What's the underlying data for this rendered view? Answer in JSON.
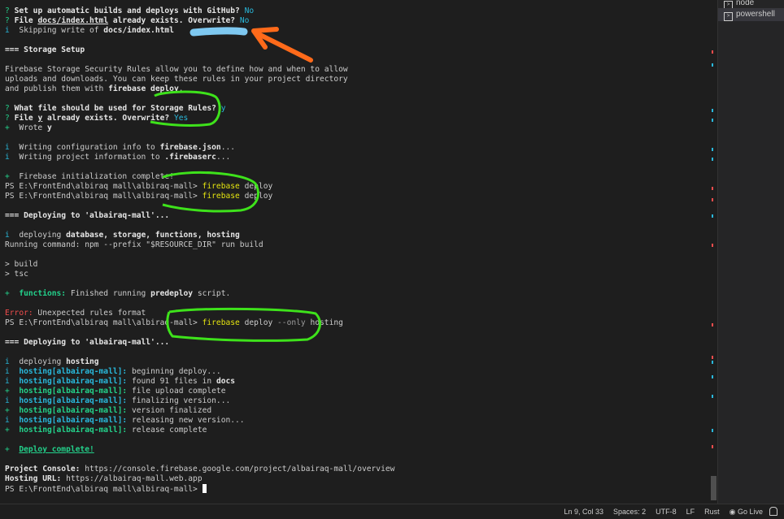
{
  "terminal": {
    "lines": [
      [
        [
          "? ",
          "green"
        ],
        [
          "Set up automatic builds and deploys with GitHub? ",
          "b"
        ],
        [
          "No",
          "cyan"
        ]
      ],
      [
        [
          "? ",
          "green"
        ],
        [
          "File ",
          "b"
        ],
        [
          "docs/index.html",
          "ul"
        ],
        [
          " already exists. Overwrite? ",
          "b"
        ],
        [
          "No",
          "cyan"
        ]
      ],
      [
        [
          "i  ",
          "cyan"
        ],
        [
          "Skipping write of ",
          "dim"
        ],
        [
          "docs/index.html",
          "b"
        ]
      ],
      [],
      [
        [
          "=== Storage Setup",
          "b"
        ]
      ],
      [],
      [
        [
          "Firebase Storage Security Rules allow you to define how and when to allow",
          "dim"
        ]
      ],
      [
        [
          "uploads and downloads. You can keep these rules in your project directory",
          "dim"
        ]
      ],
      [
        [
          "and publish them with ",
          "dim"
        ],
        [
          "firebase deploy",
          "b"
        ],
        [
          ".",
          "dim"
        ]
      ],
      [],
      [
        [
          "? ",
          "green"
        ],
        [
          "What file should be used for Storage Rules? ",
          "b"
        ],
        [
          "y",
          "cyan"
        ]
      ],
      [
        [
          "? ",
          "green"
        ],
        [
          "File ",
          "b"
        ],
        [
          "y",
          "ul"
        ],
        [
          " already exists. Overwrite? ",
          "b"
        ],
        [
          "Yes",
          "cyan"
        ]
      ],
      [
        [
          "+  ",
          "green"
        ],
        [
          "Wrote ",
          "dim"
        ],
        [
          "y",
          "b"
        ]
      ],
      [],
      [
        [
          "i  ",
          "cyan"
        ],
        [
          "Writing configuration info to ",
          "dim"
        ],
        [
          "firebase.json",
          "b"
        ],
        [
          "...",
          "dim"
        ]
      ],
      [
        [
          "i  ",
          "cyan"
        ],
        [
          "Writing project information to ",
          "dim"
        ],
        [
          ".firebaserc",
          "b"
        ],
        [
          "...",
          "dim"
        ]
      ],
      [],
      [
        [
          "+  ",
          "green"
        ],
        [
          "Firebase initialization complete!",
          "dim"
        ]
      ],
      [
        [
          "PS E:\\FrontEnd\\albiraq mall\\albiraq-mall> ",
          "dim"
        ],
        [
          "firebase",
          "yellow"
        ],
        [
          " deploy",
          "dim"
        ]
      ],
      [
        [
          "PS E:\\FrontEnd\\albiraq mall\\albiraq-mall> ",
          "dim"
        ],
        [
          "firebase",
          "yellow"
        ],
        [
          " deploy",
          "dim"
        ]
      ],
      [],
      [
        [
          "=== Deploying to 'albairaq-mall'...",
          "b"
        ]
      ],
      [],
      [
        [
          "i  ",
          "cyan"
        ],
        [
          "deploying ",
          "dim"
        ],
        [
          "database, storage, functions, hosting",
          "b"
        ]
      ],
      [
        [
          "Running command: npm --prefix \"$RESOURCE_DIR\" run build",
          "dim"
        ]
      ],
      [],
      [
        [
          "> build",
          "dim"
        ]
      ],
      [
        [
          "> tsc",
          "dim"
        ]
      ],
      [],
      [
        [
          "+  ",
          "green"
        ],
        [
          "functions:",
          "greenb"
        ],
        [
          " Finished running ",
          "dim"
        ],
        [
          "predeploy",
          "b"
        ],
        [
          " script.",
          "dim"
        ]
      ],
      [],
      [
        [
          "Error:",
          "red"
        ],
        [
          " Unexpected rules format",
          "dim"
        ]
      ],
      [
        [
          "PS E:\\FrontEnd\\albiraq mall\\albiraq-mall> ",
          "dim"
        ],
        [
          "firebase",
          "yellow"
        ],
        [
          " deploy ",
          "dim"
        ],
        [
          "--only",
          "gray"
        ],
        [
          " hosting",
          "dim"
        ]
      ],
      [],
      [
        [
          "=== Deploying to 'albairaq-mall'...",
          "b"
        ]
      ],
      [],
      [
        [
          "i  ",
          "cyan"
        ],
        [
          "deploying ",
          "dim"
        ],
        [
          "hosting",
          "b"
        ]
      ],
      [
        [
          "i  ",
          "cyan"
        ],
        [
          "hosting[albairaq-mall]:",
          "cyanb"
        ],
        [
          " beginning deploy...",
          "dim"
        ]
      ],
      [
        [
          "i  ",
          "cyan"
        ],
        [
          "hosting[albairaq-mall]:",
          "cyanb"
        ],
        [
          " found 91 files in ",
          "dim"
        ],
        [
          "docs",
          "b"
        ]
      ],
      [
        [
          "+  ",
          "green"
        ],
        [
          "hosting[albairaq-mall]:",
          "greenb"
        ],
        [
          " file upload complete",
          "dim"
        ]
      ],
      [
        [
          "i  ",
          "cyan"
        ],
        [
          "hosting[albairaq-mall]:",
          "cyanb"
        ],
        [
          " finalizing version...",
          "dim"
        ]
      ],
      [
        [
          "+  ",
          "green"
        ],
        [
          "hosting[albairaq-mall]:",
          "greenb"
        ],
        [
          " version finalized",
          "dim"
        ]
      ],
      [
        [
          "i  ",
          "cyan"
        ],
        [
          "hosting[albairaq-mall]:",
          "cyanb"
        ],
        [
          " releasing new version...",
          "dim"
        ]
      ],
      [
        [
          "+  ",
          "green"
        ],
        [
          "hosting[albairaq-mall]:",
          "greenb"
        ],
        [
          " release complete",
          "dim"
        ]
      ],
      [],
      [
        [
          "+  ",
          "green"
        ],
        [
          "Deploy complete!",
          "ulg"
        ]
      ],
      [],
      [
        [
          "Project Console:",
          "b"
        ],
        [
          " https://console.firebase.google.com/project/albairaq-mall/overview",
          "dim"
        ]
      ],
      [
        [
          "Hosting URL:",
          "b"
        ],
        [
          " https://albairaq-mall.web.app",
          "dim"
        ]
      ],
      [
        [
          "PS E:\\FrontEnd\\albiraq mall\\albiraq-mall> ",
          "dim"
        ]
      ]
    ]
  },
  "tabs": [
    {
      "label": "node",
      "icon": "terminal-icon"
    },
    {
      "label": "powershell",
      "icon": "terminal-icon"
    }
  ],
  "statusbar": {
    "position": "Ln 9, Col 33",
    "spaces": "Spaces: 2",
    "encoding": "UTF-8",
    "eol": "LF",
    "language": "Rust",
    "golive": "Go Live"
  },
  "colors": {
    "annotation_arrow": "#ff6a1a",
    "annotation_circle": "#3ee21b",
    "annotation_highlight": "#7ec8f0"
  }
}
